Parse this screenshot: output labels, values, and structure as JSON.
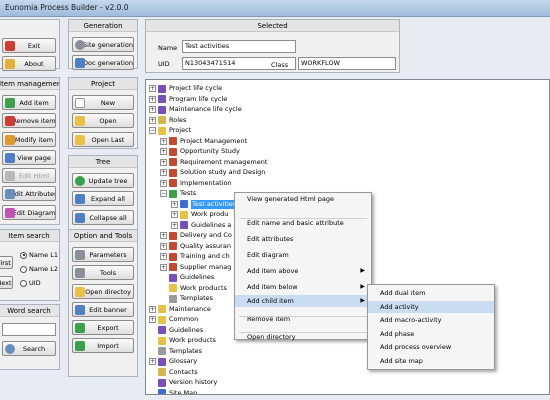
{
  "window": {
    "title": "Eunomia Process Builder - v2.0.0"
  },
  "panels": {
    "generation": "Generation",
    "selected": "Selected",
    "item_management": "Item management",
    "project": "Project",
    "tree": "Tree",
    "item_search": "Item search",
    "option_tools": "Option and Tools",
    "word_search": "Word search"
  },
  "buttons": {
    "exit": "Exit",
    "about": "About",
    "site_generation": "Site generation",
    "doc_generation": "Doc generation",
    "add_item": "Add item",
    "remove_item": "Remove item",
    "modify_item": "Modify item",
    "view_page": "View page",
    "edit_html": "Edit Html",
    "edit_attributes": "Edit Attributes",
    "edit_diagram": "Edit Diagram",
    "new": "New",
    "open": "Open",
    "open_last": "Open Last",
    "update_tree": "Update tree",
    "expand_all": "Expand all",
    "collapse_all": "Collapse all",
    "parameters": "Parameters",
    "tools": "Tools",
    "open_directory": "Open directoy",
    "edit_banner": "Edit banner",
    "export": "Export",
    "import": "Import",
    "first": "First",
    "next": "Next",
    "search": "Search"
  },
  "selected": {
    "name_label": "Name",
    "name_value": "Test activities",
    "uid_label": "UID",
    "uid_value": "N13043471514",
    "class_label": "Class",
    "class_value": "WORKFLOW"
  },
  "item_search": {
    "options": [
      "Name L1",
      "Name L2",
      "UID"
    ],
    "selected": "Name L1"
  },
  "tree_nodes": [
    "Project life cycle",
    "Program life cycle",
    "Maintenance life cycle",
    "Roles",
    "Project",
    "Project Management",
    "Opportunity Study",
    "Requirement management",
    "Solution study and Design",
    "Implementation",
    "Tests",
    "Test activities",
    "Work produ",
    "Guidelines a",
    "Delivery and Co",
    "Quality assuran",
    "Training and ch",
    "Supplier manag",
    "Guidelines",
    "Work products",
    "Templates",
    "Maintenance",
    "Common",
    "Guidelines",
    "Work products",
    "Templates",
    "Glossary",
    "Contacts",
    "Version history",
    "Site Map"
  ],
  "context_menu": [
    "View generated Html page",
    "Edit name and basic attribute",
    "Edit attributes",
    "Edit diagram",
    "Add item above",
    "Add item below",
    "Add child item",
    "Remove item",
    "Open directory"
  ],
  "submenu": [
    "Add dual item",
    "Add activity",
    "Add macro-activity",
    "Add phase",
    "Add process overview",
    "Add site map"
  ],
  "colors": {
    "selection": "#3399ff",
    "menu_highlight": "#c9dcf2",
    "title_bar": "#9fbcdc"
  }
}
